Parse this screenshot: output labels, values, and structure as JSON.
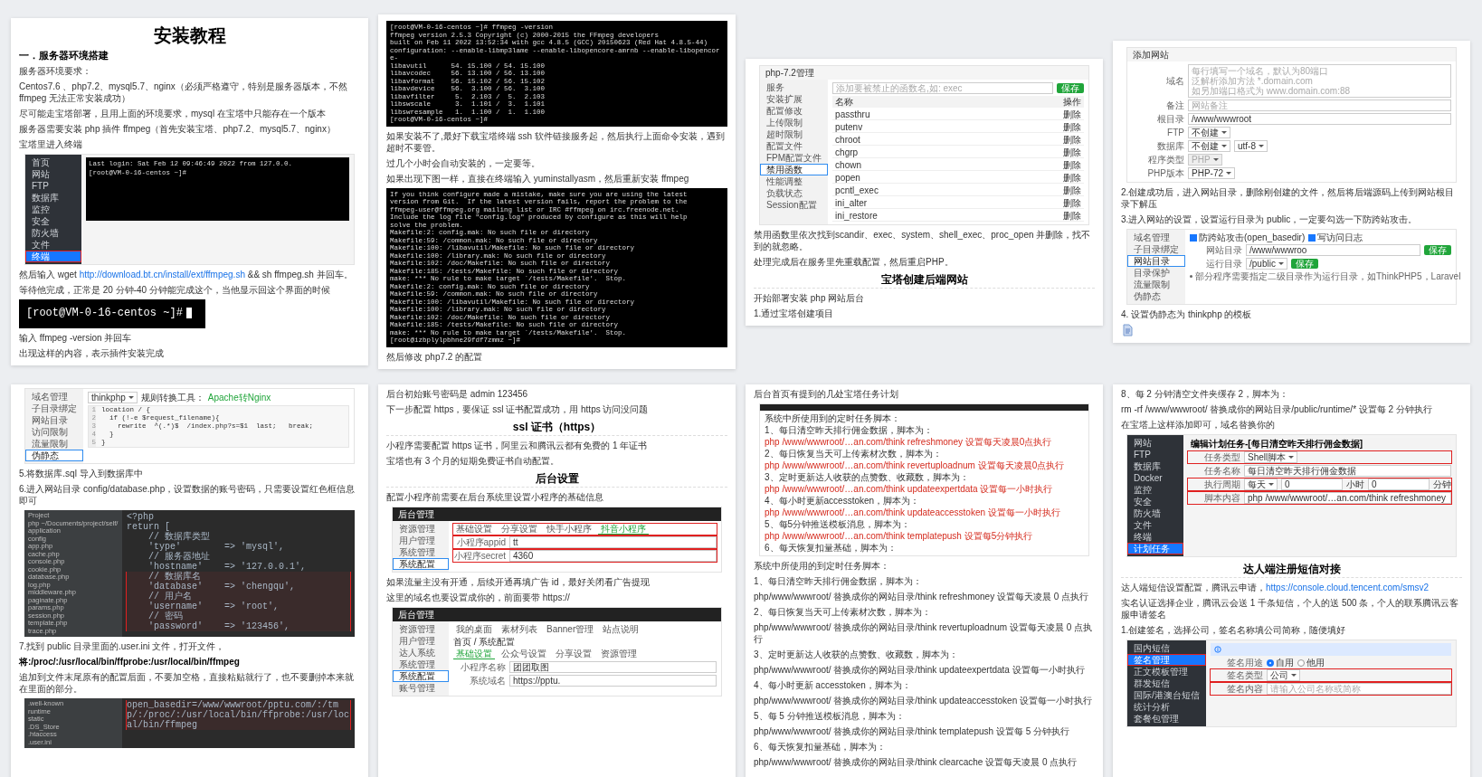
{
  "pages": [
    {
      "blocks": [
        {
          "kind": "title",
          "text": "安装教程"
        },
        {
          "kind": "heading",
          "text": "一．服务器环境搭建"
        },
        {
          "kind": "para",
          "text": "服务器环境要求："
        },
        {
          "kind": "para",
          "text": "Centos7.6 、php7.2、mysql5.7、nginx（必须严格遵守，特别是服务器版本，不然 ffmpeg 无法正常安装成功）"
        },
        {
          "kind": "para",
          "text": "尽可能走宝塔部署，且用上面的环境要求，mysql 在宝塔中只能存在一个版本"
        },
        {
          "kind": "para",
          "text": "服务器需要安装 php 插件 ffmpeg（首先安装宝塔、php7.2、mysql5.7、nginx）"
        },
        {
          "kind": "para",
          "text": "宝塔里进入终端"
        },
        {
          "kind": "dark_shot",
          "sidebar": [
            {
              "label": "首页",
              "selected": false
            },
            {
              "label": "网站",
              "selected": false
            },
            {
              "label": "FTP",
              "selected": false
            },
            {
              "label": "数据库",
              "selected": false
            },
            {
              "label": "监控",
              "selected": false
            },
            {
              "label": "安全",
              "selected": false
            },
            {
              "label": "防火墙",
              "selected": false
            },
            {
              "label": "文件",
              "selected": false
            },
            {
              "label": "终端",
              "selected": true
            }
          ],
          "rows": [
            {
              "kind": "console",
              "items": [
                {
                  "kind": "mono",
                  "text": "Last login: Sat Feb 12 09:46:49 2022 from 127.0.0."
                },
                {
                  "kind": "mono",
                  "text": "[root@VM-0-16-centos ~]#"
                }
              ]
            }
          ]
        },
        {
          "kind": "para",
          "parts": [
            {
              "kind": "text",
              "text": "然后输入 wget "
            },
            {
              "kind": "link",
              "text": "http://download.bt.cn/install/ext/ffmpeg.sh"
            },
            {
              "kind": "text",
              "text": " && sh ffmpeg.sh 并回车。"
            }
          ]
        },
        {
          "kind": "para",
          "text": "等待他完成，正常是 20 分钟-40 分钟能完成这个，当他显示回这个界面的时候"
        },
        {
          "kind": "prompt",
          "text": "[root@VM-0-16-centos ~]#"
        },
        {
          "kind": "para",
          "text": "输入 ffmpeg -version 并回车"
        },
        {
          "kind": "para",
          "text": "出现这样的内容，表示插件安装完成"
        }
      ]
    },
    {
      "blocks": [
        {
          "kind": "terminal",
          "lines": [
            "[root@VM-0-16-centos ~]# ffmpeg -version",
            "ffmpeg version 2.5.3 Copyright (c) 2000-2015 the FFmpeg developers",
            "built on Feb 11 2022 13:52:34 with gcc 4.8.5 (GCC) 20150623 (Red Hat 4.8.5-44)",
            "configuration: --enable-libmp3lame --enable-libopencore-amrnb --enable-libopencore-",
            "libavutil      54. 15.100 / 54. 15.100",
            "libavcodec     56. 13.100 / 56. 13.100",
            "libavformat    56. 15.102 / 56. 15.102",
            "libavdevice    56.  3.100 / 56.  3.100",
            "libavfilter     5.  2.103 /  5.  2.103",
            "libswscale      3.  1.101 /  3.  1.101",
            "libswresample   1.  1.100 /  1.  1.100",
            "[root@VM-0-16-centos ~]#"
          ]
        },
        {
          "kind": "para",
          "text": "如果安装不了,最好下载宝塔终端 ssh 软件链接服务起，然后执行上面命令安装，遇到超时不要管。"
        },
        {
          "kind": "para",
          "text": "过几个小时会自动安装的，一定要等。"
        },
        {
          "kind": "para",
          "text": "如果出现下图一样，直接在终端输入 yuminstallyasm，然后重新安装 ffmpeg"
        },
        {
          "kind": "terminal",
          "lines": [
            "If you think configure made a mistake, make sure you are using the latest",
            "version from Git.  If the latest version fails, report the problem to the",
            "ffmpeg-user@ffmpeg.org mailing list or IRC #ffmpeg on irc.freenode.net.",
            "Include the log file \"config.log\" produced by configure as this will help",
            "solve the problem.",
            "Makefile:2: config.mak: No such file or directory",
            "Makefile:59: /common.mak: No such file or directory",
            "Makefile:100: /libavutil/Makefile: No such file or directory",
            "Makefile:100: /library.mak: No such file or directory",
            "Makefile:102: /doc/Makefile: No such file or directory",
            "Makefile:185: /tests/Makefile: No such file or directory",
            "make: *** No rule to make target `/tests/Makefile'.  Stop.",
            "Makefile:2: config.mak: No such file or directory",
            "Makefile:59: /common.mak: No such file or directory",
            "Makefile:100: /libavutil/Makefile: No such file or directory",
            "Makefile:100: /library.mak: No such file or directory",
            "Makefile:102: /doc/Makefile: No such file or directory",
            "Makefile:185: /tests/Makefile: No such file or directory",
            "make: *** No rule to make target `/tests/Makefile'.  Stop.",
            "[root@izbplylpbhne29fdf7zmmz ~]#"
          ]
        },
        {
          "kind": "para",
          "text": "然后修改 php7.2 的配置"
        }
      ]
    },
    {
      "blocks": [
        {
          "kind": "shot",
          "header": "php-7.2管理",
          "sidebar": [
            {
              "label": "服务",
              "selected": false
            },
            {
              "label": "安装扩展",
              "selected": false
            },
            {
              "label": "配置修改",
              "selected": false
            },
            {
              "label": "上传限制",
              "selected": false
            },
            {
              "label": "超时限制",
              "selected": false
            },
            {
              "label": "配置文件",
              "selected": false
            },
            {
              "label": "FPM配置文件",
              "selected": false
            },
            {
              "label": "禁用函数",
              "selected": true
            },
            {
              "label": "性能调整",
              "selected": false
            },
            {
              "label": "负载状态",
              "selected": false
            },
            {
              "label": "Session配置",
              "selected": false
            }
          ],
          "rows": [
            {
              "kind": "plain",
              "items": [
                {
                  "kind": "input",
                  "placeholder": "添加要被禁止的函数名,如: exec"
                },
                {
                  "kind": "button",
                  "text": "保存"
                }
              ]
            },
            {
              "kind": "head",
              "items": [
                {
                  "kind": "text",
                  "text": "名称"
                },
                {
                  "kind": "text",
                  "text": "操作"
                }
              ]
            },
            {
              "kind": "table",
              "items": [
                {
                  "kind": "text",
                  "text": "passthru"
                },
                {
                  "kind": "action",
                  "text": "删除"
                }
              ]
            },
            {
              "kind": "table",
              "items": [
                {
                  "kind": "text",
                  "text": "putenv"
                },
                {
                  "kind": "action",
                  "text": "删除"
                }
              ]
            },
            {
              "kind": "table",
              "items": [
                {
                  "kind": "text",
                  "text": "chroot"
                },
                {
                  "kind": "action",
                  "text": "删除"
                }
              ]
            },
            {
              "kind": "table",
              "items": [
                {
                  "kind": "text",
                  "text": "chgrp"
                },
                {
                  "kind": "action",
                  "text": "删除"
                }
              ]
            },
            {
              "kind": "table",
              "items": [
                {
                  "kind": "text",
                  "text": "chown"
                },
                {
                  "kind": "action",
                  "text": "删除"
                }
              ]
            },
            {
              "kind": "table",
              "items": [
                {
                  "kind": "text",
                  "text": "popen"
                },
                {
                  "kind": "action",
                  "text": "删除"
                }
              ]
            },
            {
              "kind": "table",
              "items": [
                {
                  "kind": "text",
                  "text": "pcntl_exec"
                },
                {
                  "kind": "action",
                  "text": "删除"
                }
              ]
            },
            {
              "kind": "table",
              "items": [
                {
                  "kind": "text",
                  "text": "ini_alter"
                },
                {
                  "kind": "action",
                  "text": "删除"
                }
              ]
            },
            {
              "kind": "table",
              "items": [
                {
                  "kind": "text",
                  "text": "ini_restore"
                },
                {
                  "kind": "action",
                  "text": "删除"
                }
              ]
            }
          ]
        },
        {
          "kind": "para",
          "text": "禁用函数里依次找到scandir、exec、system、shell_exec、proc_open 并删除，找不到的就忽略。"
        },
        {
          "kind": "para",
          "text": "处理完成后在服务里先重载配置，然后重启PHP。"
        },
        {
          "kind": "section",
          "text": "宝塔创建后端网站"
        },
        {
          "kind": "para",
          "text": "开始部署安装 php 网站后台"
        },
        {
          "kind": "para",
          "text": "1.通过宝塔创建项目"
        }
      ]
    },
    {
      "blocks": [
        {
          "kind": "shot",
          "header": "添加网站",
          "rows": [
            {
              "kind": "form",
              "label": "域名",
              "items": [
                {
                  "kind": "textarea",
                  "lines": [
                    "每行填写一个域名，默认为80端口",
                    "泛解析添加方法 *.domain.com",
                    "如另加端口格式为 www.domain.com:88"
                  ]
                }
              ]
            },
            {
              "kind": "form",
              "label": "备注",
              "items": [
                {
                  "kind": "input",
                  "placeholder": "网站备注"
                }
              ]
            },
            {
              "kind": "form",
              "label": "根目录",
              "items": [
                {
                  "kind": "input",
                  "value": "/www/wwwroot"
                }
              ]
            },
            {
              "kind": "form",
              "label": "FTP",
              "items": [
                {
                  "kind": "select",
                  "value": "不创建",
                  "disabled": false
                }
              ]
            },
            {
              "kind": "form",
              "label": "数据库",
              "items": [
                {
                  "kind": "select",
                  "value": "不创建",
                  "disabled": false
                },
                {
                  "kind": "select",
                  "value": "utf-8",
                  "disabled": false
                }
              ]
            },
            {
              "kind": "form",
              "label": "程序类型",
              "items": [
                {
                  "kind": "select",
                  "value": "PHP",
                  "disabled": true
                }
              ]
            },
            {
              "kind": "form",
              "label": "PHP版本",
              "items": [
                {
                  "kind": "select",
                  "value": "PHP-72",
                  "disabled": false
                }
              ]
            }
          ]
        },
        {
          "kind": "para",
          "text": "2.创建成功后，进入网站目录，删除刚创建的文件，然后将后端源码上传到网站根目录下解压"
        },
        {
          "kind": "para",
          "text": "3.进入网站的设置，设置运行目录为 public，一定要勾选一下防跨站攻击。"
        },
        {
          "kind": "shot",
          "sidebar": [
            {
              "label": "域名管理",
              "selected": false
            },
            {
              "label": "子目录绑定",
              "selected": false
            },
            {
              "label": "网站目录",
              "selected": true
            },
            {
              "label": "目录保护",
              "selected": false
            },
            {
              "label": "流量限制",
              "selected": false
            },
            {
              "label": "伪静态",
              "selected": false
            }
          ],
          "rows": [
            {
              "kind": "plain",
              "items": [
                {
                  "kind": "check",
                  "text": "防跨站攻击(open_basedir)",
                  "checked": true
                },
                {
                  "kind": "check",
                  "text": "写访问日志",
                  "checked": true
                }
              ]
            },
            {
              "kind": "form",
              "label": "网站目录",
              "items": [
                {
                  "kind": "input",
                  "value": "/www/wwwroo"
                },
                {
                  "kind": "button",
                  "text": "保存"
                }
              ]
            },
            {
              "kind": "form",
              "label": "运行目录",
              "items": [
                {
                  "kind": "select",
                  "value": "/public",
                  "disabled": false
                },
                {
                  "kind": "button",
                  "text": "保存"
                }
              ]
            },
            {
              "kind": "plain",
              "items": [
                {
                  "kind": "note",
                  "text": "部分程序需要指定二级目录作为运行目录，如ThinkPHP5，Laravel"
                }
              ]
            }
          ]
        },
        {
          "kind": "para",
          "text": "4. 设置伪静态为 thinkphp 的模板"
        }
      ]
    },
    {
      "blocks": [
        {
          "kind": "shot",
          "sidebar": [
            {
              "label": "域名管理",
              "selected": false
            },
            {
              "label": "子目录绑定",
              "selected": false
            },
            {
              "label": "网站目录",
              "selected": false
            },
            {
              "label": "访问限制",
              "selected": false
            },
            {
              "label": "流量限制",
              "selected": false
            },
            {
              "label": "伪静态",
              "selected": true
            }
          ],
          "rows": [
            {
              "kind": "plain",
              "items": [
                {
                  "kind": "select",
                  "value": "thinkphp",
                  "disabled": false
                },
                {
                  "kind": "text",
                  "text": "规则转换工具："
                },
                {
                  "kind": "link",
                  "text": "Apache转Nginx"
                }
              ]
            },
            {
              "kind": "code",
              "items": [
                {
                  "kind": "line",
                  "number": "1",
                  "text": "location / {"
                },
                {
                  "kind": "line",
                  "number": "2",
                  "text": "  if (!-e $request_filename){"
                },
                {
                  "kind": "line",
                  "number": "3",
                  "text": "    rewrite  ^(.*)$  /index.php?s=$1  last;   break;"
                },
                {
                  "kind": "line",
                  "number": "4",
                  "text": "  }"
                },
                {
                  "kind": "line",
                  "number": "5",
                  "text": "}"
                }
              ]
            }
          ]
        },
        {
          "kind": "para",
          "text": "5.将数据库.sql 导入到数据库中"
        },
        {
          "kind": "para",
          "text": "6.进入网站目录 config/database.php，设置数据的账号密码，只需要设置红色框信息即可"
        },
        {
          "kind": "ide",
          "tree": [
            "Project",
            "php ~/Documents/project/self/",
            "application",
            "config",
            "app.php",
            "cache.php",
            "console.php",
            "cookie.php",
            "database.php",
            "log.php",
            "middleware.php",
            "paginate.php",
            "params.php",
            "session.php",
            "template.php",
            "trace.php"
          ],
          "code": [
            {
              "text": "<?php",
              "highlighted": false
            },
            {
              "text": "return [",
              "highlighted": false
            },
            {
              "text": "    // 数据库类型",
              "highlighted": false
            },
            {
              "text": "    'type'        => 'mysql',",
              "highlighted": false
            },
            {
              "text": "    // 服务器地址",
              "highlighted": false
            },
            {
              "text": "    'hostname'    => '127.0.0.1',",
              "highlighted": false
            },
            {
              "text": "    // 数据库名",
              "highlighted": true
            },
            {
              "text": "    'database'    => 'chengqu',",
              "highlighted": true
            },
            {
              "text": "    // 用户名",
              "highlighted": true
            },
            {
              "text": "    'username'    => 'root',",
              "highlighted": true
            },
            {
              "text": "    // 密码",
              "highlighted": true
            },
            {
              "text": "    'password'    => '123456',",
              "highlighted": true
            }
          ]
        },
        {
          "kind": "para",
          "text": "7.找到 public 目录里面的.user.ini 文件，打开文件，"
        },
        {
          "kind": "bold_para",
          "text": "将:/proc/:/usr/local/bin/ffprobe:/usr/local/bin/ffmpeg"
        },
        {
          "kind": "para",
          "text": "追加到文件末尾原有的配置后面，不要加空格，直接粘贴就行了，也不要删掉本来就在里面的部分。"
        },
        {
          "kind": "ide",
          "tree": [
            ".well-known",
            "runtime",
            "static",
            ".DS_Store",
            ".htaccess",
            ".user.ini"
          ],
          "code": [
            {
              "text": "open_basedir=/www/wwwroot/pptu.com/:/tmp/:/proc/:/usr/local/bin/ffprobe:/usr/local/bin/ffmpeg",
              "highlighted": true
            }
          ]
        }
      ]
    },
    {
      "blocks": [
        {
          "kind": "para",
          "text": "后台初始账号密码是  admin 123456"
        },
        {
          "kind": "para",
          "text": "下一步配置 https，要保证 ssl 证书配置成功，用 https 访问没问题"
        },
        {
          "kind": "section",
          "text": "ssl 证书（https）"
        },
        {
          "kind": "para",
          "text": "小程序需要配置 https 证书，阿里云和腾讯云都有免费的 1 年证书"
        },
        {
          "kind": "para",
          "text": "宝塔也有 3 个月的短期免费证书自动配置。"
        },
        {
          "kind": "section",
          "text": "后台设置"
        },
        {
          "kind": "para",
          "text": "配置小程序前需要在后台系统里设置小程序的基础信息"
        },
        {
          "kind": "shot",
          "header": "后台管理",
          "sidebar": [
            {
              "label": "资源管理",
              "selected": false
            },
            {
              "label": "用户管理",
              "selected": false
            },
            {
              "label": "系统管理",
              "selected": false
            },
            {
              "label": "系统配置",
              "selected": true
            }
          ],
          "rows": [
            {
              "kind": "tabs",
              "items": [
                {
                  "kind": "tab",
                  "text": "基础设置",
                  "selected": false
                },
                {
                  "kind": "tab",
                  "text": "分享设置",
                  "selected": false
                },
                {
                  "kind": "tab",
                  "text": "快手小程序",
                  "selected": false
                },
                {
                  "kind": "tab",
                  "text": "抖音小程序",
                  "selected": true
                }
              ],
              "highlighted": true
            },
            {
              "kind": "form",
              "label": "小程序appid",
              "items": [
                {
                  "kind": "input",
                  "value": "tt"
                }
              ],
              "highlighted": true
            },
            {
              "kind": "form",
              "label": "小程序secret",
              "items": [
                {
                  "kind": "input",
                  "value": "4360"
                }
              ],
              "highlighted": true
            }
          ]
        },
        {
          "kind": "para",
          "text": "如果流量主没有开通，后续开通再填广告 id，最好关闭看广告提现"
        },
        {
          "kind": "para",
          "text": "这里的域名也要设置成你的，前面要带 https://"
        },
        {
          "kind": "shot",
          "header": "后台管理",
          "sidebar": [
            {
              "label": "资源管理",
              "selected": false
            },
            {
              "label": "用户管理",
              "selected": false
            },
            {
              "label": "达人系统",
              "selected": false
            },
            {
              "label": "系统管理",
              "selected": false
            },
            {
              "label": "系统配置",
              "selected": true
            },
            {
              "label": "账号管理",
              "selected": false
            }
          ],
          "rows": [
            {
              "kind": "tabs",
              "items": [
                {
                  "kind": "tab",
                  "text": "我的桌面",
                  "selected": false
                },
                {
                  "kind": "tab",
                  "text": "素材列表",
                  "selected": false
                },
                {
                  "kind": "tab",
                  "text": "Banner管理",
                  "selected": false
                },
                {
                  "kind": "tab",
                  "text": "站点说明",
                  "selected": false
                }
              ]
            },
            {
              "kind": "plain",
              "items": [
                {
                  "kind": "text",
                  "text": "首页 / 系统配置"
                }
              ]
            },
            {
              "kind": "tabs",
              "items": [
                {
                  "kind": "tab",
                  "text": "基础设置",
                  "selected": true
                },
                {
                  "kind": "tab",
                  "text": "公众号设置",
                  "selected": false
                },
                {
                  "kind": "tab",
                  "text": "分享设置",
                  "selected": false
                },
                {
                  "kind": "tab",
                  "text": "资源管理",
                  "selected": false
                }
              ]
            },
            {
              "kind": "form",
              "label": "小程序名称",
              "items": [
                {
                  "kind": "input",
                  "value": "团团取图"
                }
              ]
            },
            {
              "kind": "form",
              "label": "系统域名",
              "items": [
                {
                  "kind": "input",
                  "value": "https://pptu."
                }
              ]
            }
          ]
        }
      ]
    },
    {
      "blocks": [
        {
          "kind": "para",
          "text": "后台首页有提到的几处宝塔任务计划"
        },
        {
          "kind": "shot",
          "bar": true,
          "rows": [
            {
              "kind": "plain",
              "items": [
                {
                  "kind": "text",
                  "text": "系统中所使用到的定时任务脚本："
                }
              ]
            },
            {
              "kind": "plain",
              "items": [
                {
                  "kind": "text",
                  "text": "1、每日清空昨天排行佣金数据，脚本为："
                }
              ]
            },
            {
              "kind": "plain",
              "items": [
                {
                  "kind": "script",
                  "text": "php /www/wwwroot/…an.com/think refreshmoney 设置每天凌晨0点执行"
                }
              ]
            },
            {
              "kind": "plain",
              "items": [
                {
                  "kind": "text",
                  "text": "2、每日恢复当天可上传素材次数，脚本为："
                }
              ]
            },
            {
              "kind": "plain",
              "items": [
                {
                  "kind": "script",
                  "text": "php /www/wwwroot/…an.com/think revertuploadnum 设置每天凌晨0点执行"
                }
              ]
            },
            {
              "kind": "plain",
              "items": [
                {
                  "kind": "text",
                  "text": "3、定时更新达人收获的点赞数、收藏数，脚本为："
                }
              ]
            },
            {
              "kind": "plain",
              "items": [
                {
                  "kind": "script",
                  "text": "php /www/wwwroot/…an.com/think updateexpertdata 设置每一小时执行"
                }
              ]
            },
            {
              "kind": "plain",
              "items": [
                {
                  "kind": "text",
                  "text": "4、每小时更新accesstoken，脚本为："
                }
              ]
            },
            {
              "kind": "plain",
              "items": [
                {
                  "kind": "script",
                  "text": "php /www/wwwroot/…an.com/think updateaccesstoken 设置每一小时执行"
                }
              ]
            },
            {
              "kind": "plain",
              "items": [
                {
                  "kind": "text",
                  "text": "5、每5分钟推送模板消息，脚本为："
                }
              ]
            },
            {
              "kind": "plain",
              "items": [
                {
                  "kind": "script",
                  "text": "php /www/wwwroot/…an.com/think templatepush 设置每5分钟执行"
                }
              ]
            },
            {
              "kind": "plain",
              "items": [
                {
                  "kind": "text",
                  "text": "6、每天恢复扣量基础，脚本为："
                }
              ]
            }
          ]
        },
        {
          "kind": "para",
          "text": "系统中所使用的到定时任务脚本："
        },
        {
          "kind": "para",
          "text": "1、每日清空昨天排行佣金数据，脚本为："
        },
        {
          "kind": "para",
          "text": "php/www/wwwroot/ 替换成你的网站目录/think refreshmoney 设置每天凌晨 0 点执行"
        },
        {
          "kind": "para",
          "text": "2、每日恢复当天可上传素材次数，脚本为："
        },
        {
          "kind": "para",
          "text": "php/www/wwwroot/ 替换成你的网站目录/think revertuploadnum 设置每天凌晨 0 点执行"
        },
        {
          "kind": "para",
          "text": "3、定时更新达人收获的点赞数、收藏数，脚本为："
        },
        {
          "kind": "para",
          "text": "php/www/wwwroot/ 替换成你的网站目录/think updateexpertdata 设置每一小时执行"
        },
        {
          "kind": "para",
          "text": "4、每小时更新 accesstoken，脚本为："
        },
        {
          "kind": "para",
          "text": "php/www/wwwroot/ 替换成你的网站目录/think updateaccesstoken 设置每一小时执行"
        },
        {
          "kind": "para",
          "text": "5、每 5 分钟推送模板消息，脚本为："
        },
        {
          "kind": "para",
          "text": "php/www/wwwroot/ 替换成你的网站目录/think templatepush 设置每 5 分钟执行"
        },
        {
          "kind": "para",
          "text": "6、每天恢复扣量基础，脚本为："
        },
        {
          "kind": "para",
          "text": "php/www/wwwroot/ 替换成你的网站目录/think clearcache 设置每天凌晨 0 点执行"
        }
      ]
    },
    {
      "blocks": [
        {
          "kind": "para",
          "text": "8、每 2 分钟清空文件夹缓存 2，脚本为："
        },
        {
          "kind": "para",
          "text": "rm -rf /www/wwwroot/ 替换成你的网站目录/public/runtime/* 设置每 2 分钟执行"
        },
        {
          "kind": "para",
          "text": "在宝塔上这样添加即可，域名替换你的"
        },
        {
          "kind": "dark_shot",
          "sidebar": [
            {
              "label": "网站",
              "selected": false
            },
            {
              "label": "FTP",
              "selected": false
            },
            {
              "label": "数据库",
              "selected": false
            },
            {
              "label": "Docker",
              "selected": false
            },
            {
              "label": "监控",
              "selected": false
            },
            {
              "label": "安全",
              "selected": false
            },
            {
              "label": "防火墙",
              "selected": false
            },
            {
              "label": "文件",
              "selected": false
            },
            {
              "label": "终端",
              "selected": false
            },
            {
              "label": "计划任务",
              "selected": true
            }
          ],
          "rows": [
            {
              "kind": "title",
              "items": [
                {
                  "kind": "text",
                  "text": "编辑计划任务-[每日清空昨天排行佣金数据]"
                }
              ]
            },
            {
              "kind": "form",
              "label": "任务类型",
              "items": [
                {
                  "kind": "select",
                  "value": "Shell脚本",
                  "disabled": false
                }
              ],
              "highlighted": true
            },
            {
              "kind": "form",
              "label": "任务名称",
              "items": [
                {
                  "kind": "input",
                  "value": "每日清空昨天排行佣金数据"
                }
              ]
            },
            {
              "kind": "form",
              "label": "执行周期",
              "items": [
                {
                  "kind": "select",
                  "value": "每天",
                  "disabled": false
                },
                {
                  "kind": "input",
                  "value": "0"
                },
                {
                  "kind": "text",
                  "text": "小时"
                },
                {
                  "kind": "input",
                  "value": "0"
                },
                {
                  "kind": "text",
                  "text": "分钟"
                }
              ],
              "highlighted": true
            },
            {
              "kind": "form",
              "label": "脚本内容",
              "items": [
                {
                  "kind": "input",
                  "value": "php /www/wwwroot/…an.com/think refreshmoney"
                }
              ],
              "highlighted": true
            }
          ]
        },
        {
          "kind": "section",
          "text": "达人端注册短信对接"
        },
        {
          "kind": "para",
          "parts": [
            {
              "kind": "text",
              "text": "达人端短信设置配置，腾讯云申请，"
            },
            {
              "kind": "link",
              "text": "https://console.cloud.tencent.com/smsv2"
            }
          ]
        },
        {
          "kind": "para",
          "text": "实名认证选择企业，腾讯云会送 1 千条短信，个人的送 500 条，个人的联系腾讯云客服申请签名"
        },
        {
          "kind": "para",
          "text": "1.创建签名，选择公司，签名名称填公司简称，随便填好"
        },
        {
          "kind": "dark_shot",
          "sidebar": [
            {
              "label": "国内短信",
              "selected": false
            },
            {
              "label": "签名管理",
              "selected": true
            },
            {
              "label": "正文模板管理",
              "selected": false
            },
            {
              "label": "群发短信",
              "selected": false
            },
            {
              "label": "国际/港澳台短信",
              "selected": false
            },
            {
              "label": "统计分析",
              "selected": false
            },
            {
              "label": "套餐包管理",
              "selected": false
            }
          ],
          "rows": [
            {
              "kind": "info",
              "items": []
            },
            {
              "kind": "form",
              "label": "签名用途",
              "items": [
                {
                  "kind": "radio",
                  "text": "自用",
                  "selected": true
                },
                {
                  "kind": "radio",
                  "text": "他用",
                  "selected": false
                }
              ]
            },
            {
              "kind": "form",
              "label": "签名类型",
              "items": [
                {
                  "kind": "select",
                  "value": "公司",
                  "disabled": false
                }
              ],
              "highlighted": true
            },
            {
              "kind": "form",
              "label": "签名内容",
              "items": [
                {
                  "kind": "input",
                  "placeholder": "请输入公司名称或简称"
                }
              ],
              "highlighted": true
            }
          ]
        }
      ]
    }
  ]
}
